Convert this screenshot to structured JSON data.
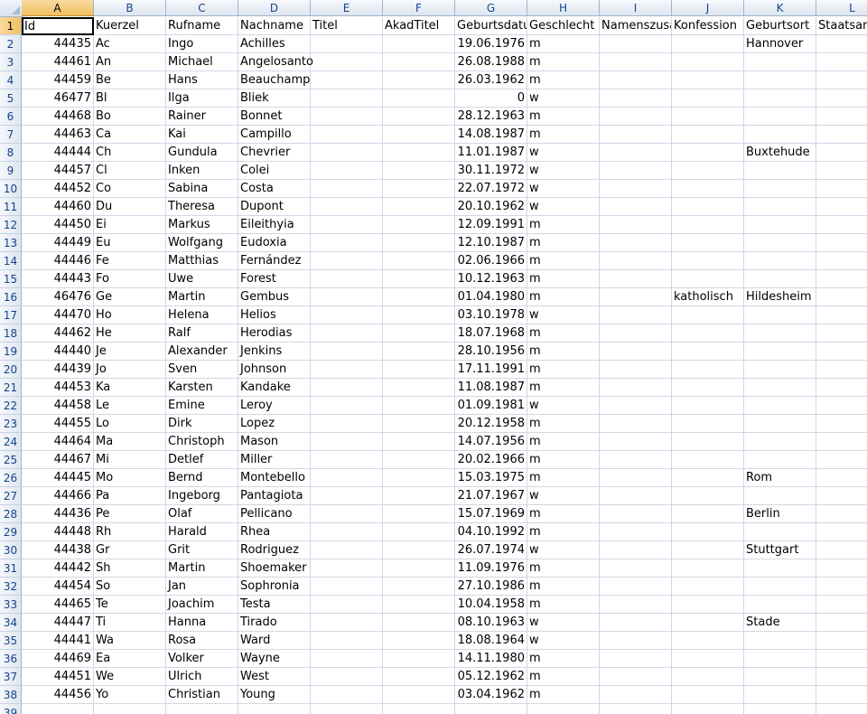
{
  "columns": [
    "A",
    "B",
    "C",
    "D",
    "E",
    "F",
    "G",
    "H",
    "I",
    "J",
    "K",
    "L"
  ],
  "header_row": [
    "Id",
    "Kuerzel",
    "Rufname",
    "Nachname",
    "Titel",
    "AkadTitel",
    "Geburtsdatum",
    "Geschlecht",
    "Namenszusatz",
    "Konfession",
    "Geburtsort",
    "Staatsangehörigkeit"
  ],
  "rows": [
    [
      "44435",
      "Ac",
      "Ingo",
      "Achilles",
      "",
      "",
      "19.06.1976",
      "m",
      "",
      "",
      "Hannover",
      ""
    ],
    [
      "44461",
      "An",
      "Michael",
      "Angelosanto",
      "",
      "",
      "26.08.1988",
      "m",
      "",
      "",
      "",
      ""
    ],
    [
      "44459",
      "Be",
      "Hans",
      "Beauchamp",
      "",
      "",
      "26.03.1962",
      "m",
      "",
      "",
      "",
      ""
    ],
    [
      "46477",
      "Bl",
      "Ilga",
      "Bliek",
      "",
      "",
      "0",
      "w",
      "",
      "",
      "",
      ""
    ],
    [
      "44468",
      "Bo",
      "Rainer",
      "Bonnet",
      "",
      "",
      "28.12.1963",
      "m",
      "",
      "",
      "",
      ""
    ],
    [
      "44463",
      "Ca",
      "Kai",
      "Campillo",
      "",
      "",
      "14.08.1987",
      "m",
      "",
      "",
      "",
      ""
    ],
    [
      "44444",
      "Ch",
      "Gundula",
      "Chevrier",
      "",
      "",
      "11.01.1987",
      "w",
      "",
      "",
      "Buxtehude",
      ""
    ],
    [
      "44457",
      "Cl",
      "Inken",
      "Colei",
      "",
      "",
      "30.11.1972",
      "w",
      "",
      "",
      "",
      ""
    ],
    [
      "44452",
      "Co",
      "Sabina",
      "Costa",
      "",
      "",
      "22.07.1972",
      "w",
      "",
      "",
      "",
      ""
    ],
    [
      "44460",
      "Du",
      "Theresa",
      "Dupont",
      "",
      "",
      "20.10.1962",
      "w",
      "",
      "",
      "",
      ""
    ],
    [
      "44450",
      "Ei",
      "Markus",
      "Eileithyia",
      "",
      "",
      "12.09.1991",
      "m",
      "",
      "",
      "",
      ""
    ],
    [
      "44449",
      "Eu",
      "Wolfgang",
      "Eudoxia",
      "",
      "",
      "12.10.1987",
      "m",
      "",
      "",
      "",
      ""
    ],
    [
      "44446",
      "Fe",
      "Matthias",
      "Fernández",
      "",
      "",
      "02.06.1966",
      "m",
      "",
      "",
      "",
      ""
    ],
    [
      "44443",
      "Fo",
      "Uwe",
      "Forest",
      "",
      "",
      "10.12.1963",
      "m",
      "",
      "",
      "",
      ""
    ],
    [
      "46476",
      "Ge",
      "Martin",
      "Gembus",
      "",
      "",
      "01.04.1980",
      "m",
      "",
      "katholisch",
      "Hildesheim",
      ""
    ],
    [
      "44470",
      "Ho",
      "Helena",
      "Helios",
      "",
      "",
      "03.10.1978",
      "w",
      "",
      "",
      "",
      ""
    ],
    [
      "44462",
      "He",
      "Ralf",
      "Herodias",
      "",
      "",
      "18.07.1968",
      "m",
      "",
      "",
      "",
      ""
    ],
    [
      "44440",
      "Je",
      "Alexander",
      "Jenkins",
      "",
      "",
      "28.10.1956",
      "m",
      "",
      "",
      "",
      ""
    ],
    [
      "44439",
      "Jo",
      "Sven",
      "Johnson",
      "",
      "",
      "17.11.1991",
      "m",
      "",
      "",
      "",
      ""
    ],
    [
      "44453",
      "Ka",
      "Karsten",
      "Kandake",
      "",
      "",
      "11.08.1987",
      "m",
      "",
      "",
      "",
      ""
    ],
    [
      "44458",
      "Le",
      "Emine",
      "Leroy",
      "",
      "",
      "01.09.1981",
      "w",
      "",
      "",
      "",
      ""
    ],
    [
      "44455",
      "Lo",
      "Dirk",
      "Lopez",
      "",
      "",
      "20.12.1958",
      "m",
      "",
      "",
      "",
      ""
    ],
    [
      "44464",
      "Ma",
      "Christoph",
      "Mason",
      "",
      "",
      "14.07.1956",
      "m",
      "",
      "",
      "",
      ""
    ],
    [
      "44467",
      "Mi",
      "Detlef",
      "Miller",
      "",
      "",
      "20.02.1966",
      "m",
      "",
      "",
      "",
      ""
    ],
    [
      "44445",
      "Mo",
      "Bernd",
      "Montebello",
      "",
      "",
      "15.03.1975",
      "m",
      "",
      "",
      "Rom",
      ""
    ],
    [
      "44466",
      "Pa",
      "Ingeborg",
      "Pantagiota",
      "",
      "",
      "21.07.1967",
      "w",
      "",
      "",
      "",
      ""
    ],
    [
      "44436",
      "Pe",
      "Olaf",
      "Pellicano",
      "",
      "",
      "15.07.1969",
      "m",
      "",
      "",
      "Berlin",
      ""
    ],
    [
      "44448",
      "Rh",
      "Harald",
      "Rhea",
      "",
      "",
      "04.10.1992",
      "m",
      "",
      "",
      "",
      ""
    ],
    [
      "44438",
      "Gr",
      "Grit",
      "Rodriguez",
      "",
      "",
      "26.07.1974",
      "w",
      "",
      "",
      "Stuttgart",
      ""
    ],
    [
      "44442",
      "Sh",
      "Martin",
      "Shoemaker",
      "",
      "",
      "11.09.1976",
      "m",
      "",
      "",
      "",
      ""
    ],
    [
      "44454",
      "So",
      "Jan",
      "Sophronia",
      "",
      "",
      "27.10.1986",
      "m",
      "",
      "",
      "",
      ""
    ],
    [
      "44465",
      "Te",
      "Joachim",
      "Testa",
      "",
      "",
      "10.04.1958",
      "m",
      "",
      "",
      "",
      ""
    ],
    [
      "44447",
      "Ti",
      "Hanna",
      "Tirado",
      "",
      "",
      "08.10.1963",
      "w",
      "",
      "",
      "Stade",
      ""
    ],
    [
      "44441",
      "Wa",
      "Rosa",
      "Ward",
      "",
      "",
      "18.08.1964",
      "w",
      "",
      "",
      "",
      ""
    ],
    [
      "44469",
      "Ea",
      "Volker",
      "Wayne",
      "",
      "",
      "14.11.1980",
      "m",
      "",
      "",
      "",
      ""
    ],
    [
      "44451",
      "We",
      "Ulrich",
      "West",
      "",
      "",
      "05.12.1962",
      "m",
      "",
      "",
      "",
      ""
    ],
    [
      "44456",
      "Yo",
      "Christian",
      "Young",
      "",
      "",
      "03.04.1962",
      "m",
      "",
      "",
      "",
      ""
    ]
  ],
  "extra_row_number": "39"
}
